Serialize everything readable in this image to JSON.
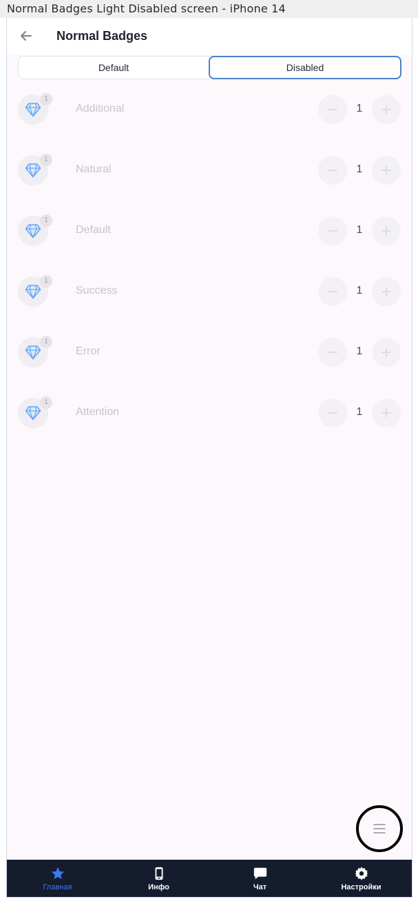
{
  "frame_title": "Normal Badges Light Disabled screen - iPhone 14",
  "appbar": {
    "title": "Normal Badges",
    "back_icon": "arrow-left-icon"
  },
  "tabs": [
    {
      "label": "Default",
      "active": false
    },
    {
      "label": "Disabled",
      "active": true
    }
  ],
  "rows": [
    {
      "label": "Additional",
      "badge": "1",
      "value": "1",
      "icon": "diamond-icon"
    },
    {
      "label": "Natural",
      "badge": "1",
      "value": "1",
      "icon": "diamond-icon"
    },
    {
      "label": "Default",
      "badge": "1",
      "value": "1",
      "icon": "diamond-icon"
    },
    {
      "label": "Success",
      "badge": "1",
      "value": "1",
      "icon": "diamond-icon"
    },
    {
      "label": "Error",
      "badge": "1",
      "value": "1",
      "icon": "diamond-icon"
    },
    {
      "label": "Attention",
      "badge": "1",
      "value": "1",
      "icon": "diamond-icon"
    }
  ],
  "fab": {
    "icon": "menu-icon"
  },
  "bottom_nav": [
    {
      "label": "Главная",
      "icon": "star-icon",
      "active": true
    },
    {
      "label": "Инфо",
      "icon": "phone-icon",
      "active": false
    },
    {
      "label": "Чат",
      "icon": "chat-bubble-icon",
      "active": false
    },
    {
      "label": "Настройки",
      "icon": "gear-icon",
      "active": false
    }
  ],
  "colors": {
    "accent": "#3a7bef",
    "nav_background": "#141c2e",
    "tab_border_active": "#4a80c8",
    "diamond": "#6aa6f0",
    "disabled_text": "#c3c6cd"
  }
}
